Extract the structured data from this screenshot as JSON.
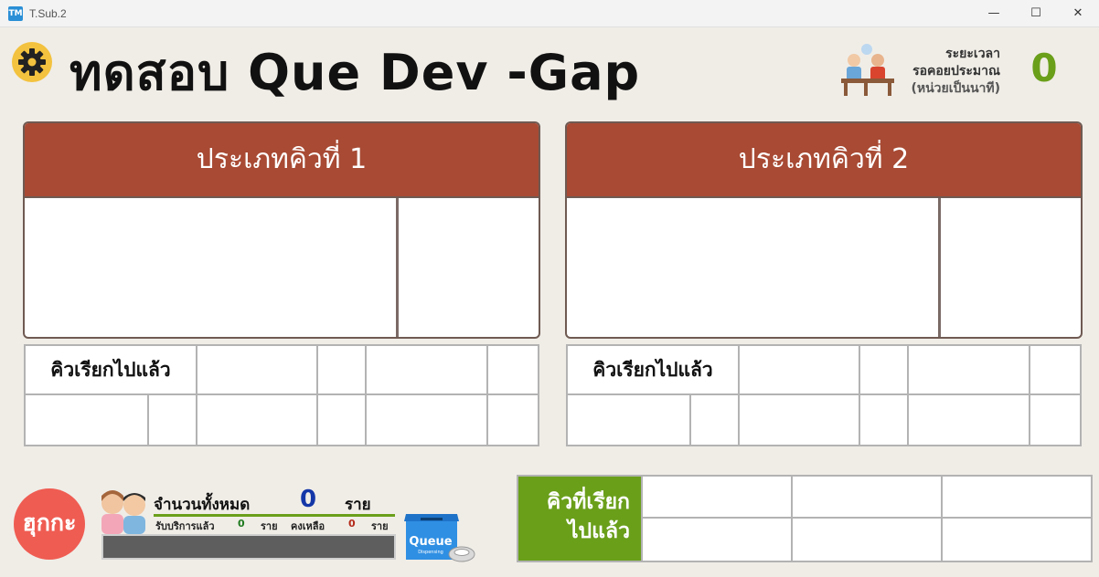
{
  "window": {
    "app_icon": "TM",
    "title": "T.Sub.2",
    "minimize_glyph": "—",
    "maximize_glyph": "☐",
    "close_glyph": "✕"
  },
  "header": {
    "title": "ทดสอบ Que Dev -Gap",
    "wait_label_line1": "ระยะเวลา",
    "wait_label_line2": "รอคอยประมาณ",
    "wait_label_line3": "(หน่วยเป็นนาที)",
    "wait_value": "0"
  },
  "queue_panels": [
    {
      "title": "ประเภทคิวที่ 1",
      "called_label": "คิวเรียกไปแล้ว"
    },
    {
      "title": "ประเภทคิวที่ 2",
      "called_label": "คิวเรียกไปแล้ว"
    }
  ],
  "stats": {
    "logo_text": "ฮุกกะ",
    "total_label": "จำนวนทั้งหมด",
    "total_value": "0",
    "total_unit": "ราย",
    "served_label": "รับบริการแล้ว",
    "served_value": "0",
    "served_unit": "ราย",
    "remaining_label": "คงเหลือ",
    "remaining_value": "0",
    "remaining_unit": "ราย",
    "queue_box_label": "Queue",
    "queue_box_sub": "Dispensing"
  },
  "recent_called": {
    "label_line1": "คิวที่เรียก",
    "label_line2": "ไปแล้ว"
  },
  "colors": {
    "panel_header": "#a84a34",
    "accent_green": "#6a9f1a",
    "total_blue": "#1437a8",
    "logo_red": "#ef5c52"
  }
}
